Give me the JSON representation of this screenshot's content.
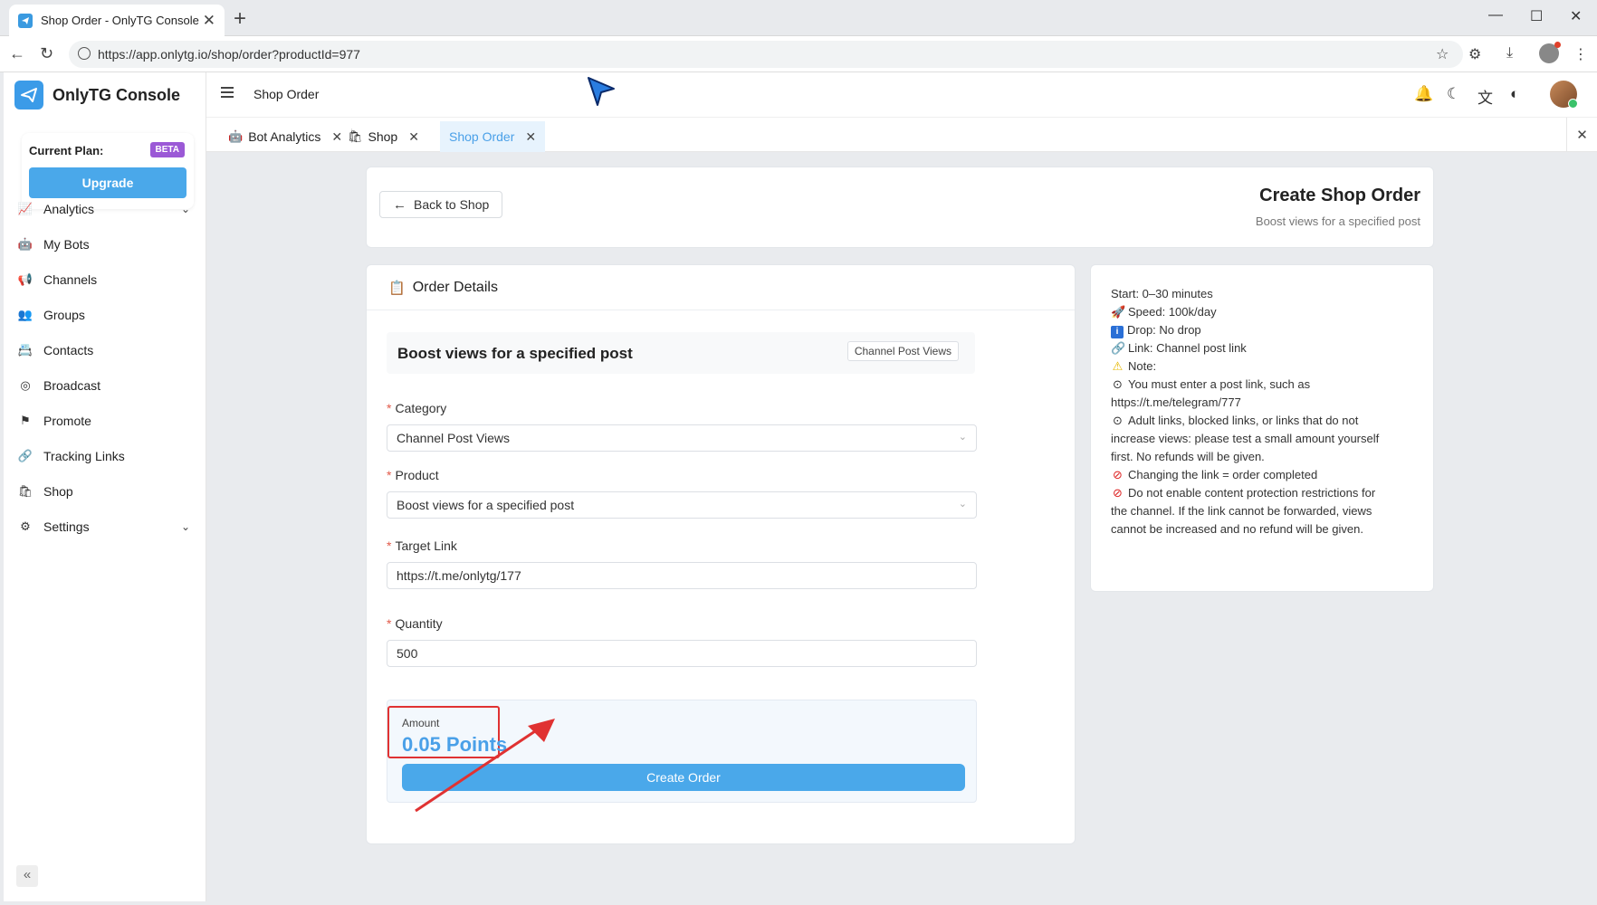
{
  "browser": {
    "tab_title": "Shop Order - OnlyTG Console",
    "url": "https://app.onlytg.io/shop/order?productId=977"
  },
  "sidebar": {
    "brand": "OnlyTG Console",
    "plan_label": "Current Plan:",
    "plan_badge": "BETA",
    "upgrade_label": "Upgrade",
    "items": [
      {
        "label": "Analytics",
        "icon": "chart-icon",
        "chevron": true
      },
      {
        "label": "My Bots",
        "icon": "bot-icon"
      },
      {
        "label": "Channels",
        "icon": "megaphone-icon"
      },
      {
        "label": "Groups",
        "icon": "users-icon"
      },
      {
        "label": "Contacts",
        "icon": "contacts-icon"
      },
      {
        "label": "Broadcast",
        "icon": "broadcast-icon"
      },
      {
        "label": "Promote",
        "icon": "promote-icon"
      },
      {
        "label": "Tracking Links",
        "icon": "link-icon"
      },
      {
        "label": "Shop",
        "icon": "shopping-bag-icon"
      },
      {
        "label": "Settings",
        "icon": "gear-icon",
        "chevron": true
      }
    ]
  },
  "header": {
    "breadcrumb": "Shop Order"
  },
  "app_tabs": [
    {
      "label": "Bot Analytics",
      "icon": "bot-icon",
      "active": false
    },
    {
      "label": "Shop",
      "icon": "shopping-bag-icon",
      "active": false
    },
    {
      "label": "Shop Order",
      "icon": "",
      "active": true
    }
  ],
  "page": {
    "back_label": "Back to Shop",
    "title": "Create Shop Order",
    "subtitle": "Boost views for a specified post"
  },
  "order": {
    "section_title": "Order Details",
    "product_title": "Boost views for a specified post",
    "product_tag": "Channel Post Views",
    "category_label": "Category",
    "category_value": "Channel Post Views",
    "product_label": "Product",
    "product_value": "Boost views for a specified post",
    "link_label": "Target Link",
    "link_value": "https://t.me/onlytg/177",
    "quantity_label": "Quantity",
    "quantity_value": "500",
    "amount_label": "Amount",
    "amount_value": "0.05 Points",
    "create_label": "Create Order"
  },
  "info": {
    "start": "Start: 0–30 minutes",
    "speed": "Speed: 100k/day",
    "drop": "Drop: No drop",
    "link": "Link: Channel post link",
    "note": "Note:",
    "note1": "You must enter a post link, such as https://t.me/telegram/777",
    "note2": "Adult links, blocked links, or links that do not increase views: please test a small amount yourself first. No refunds will be given.",
    "note3": "Changing the link = order completed",
    "note4": "Do not enable content protection restrictions for the channel. If the link cannot be forwarded, views cannot be increased and no refund will be given."
  },
  "colors": {
    "accent": "#4aa8ea",
    "badge": "#9b59d6",
    "highlight": "#e03232"
  }
}
